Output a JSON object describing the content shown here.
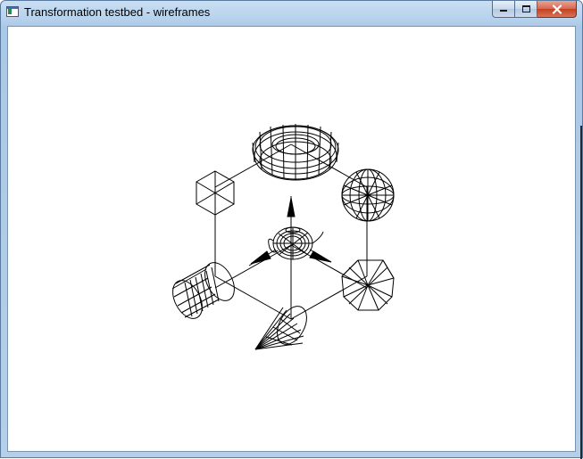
{
  "window": {
    "title": "Transformation testbed - wireframes",
    "icon": "app-window-icon",
    "buttons": [
      "minimize",
      "maximize",
      "close"
    ]
  },
  "scene": {
    "background": "#ffffff",
    "line_color": "#000000",
    "objects": [
      "torus",
      "geodesic-sphere",
      "icosahedron",
      "cone",
      "cylinder",
      "hexagon",
      "teapot",
      "axis-arrows"
    ]
  }
}
